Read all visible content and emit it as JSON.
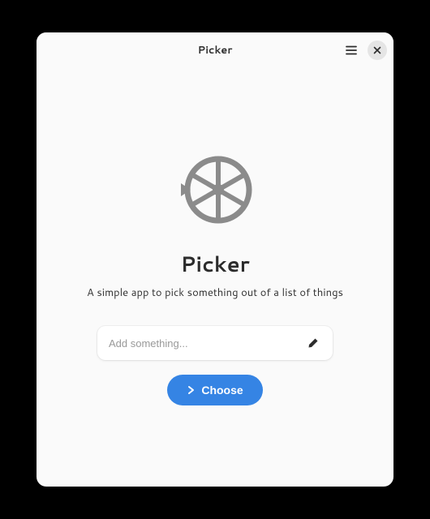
{
  "titlebar": {
    "title": "Picker"
  },
  "main": {
    "app_title": "Picker",
    "subtitle": "A simple app to pick something out of a list of things",
    "input_placeholder": "Add something...",
    "input_value": "",
    "choose_label": "Choose"
  },
  "icons": {
    "menu": "hamburger-icon",
    "close": "close-icon",
    "app": "wheel-icon",
    "edit": "pencil-icon",
    "chevron": "chevron-right-icon"
  },
  "colors": {
    "accent": "#3584e4",
    "window_bg": "#fafafa",
    "icon_gray": "#8b8b8b"
  }
}
